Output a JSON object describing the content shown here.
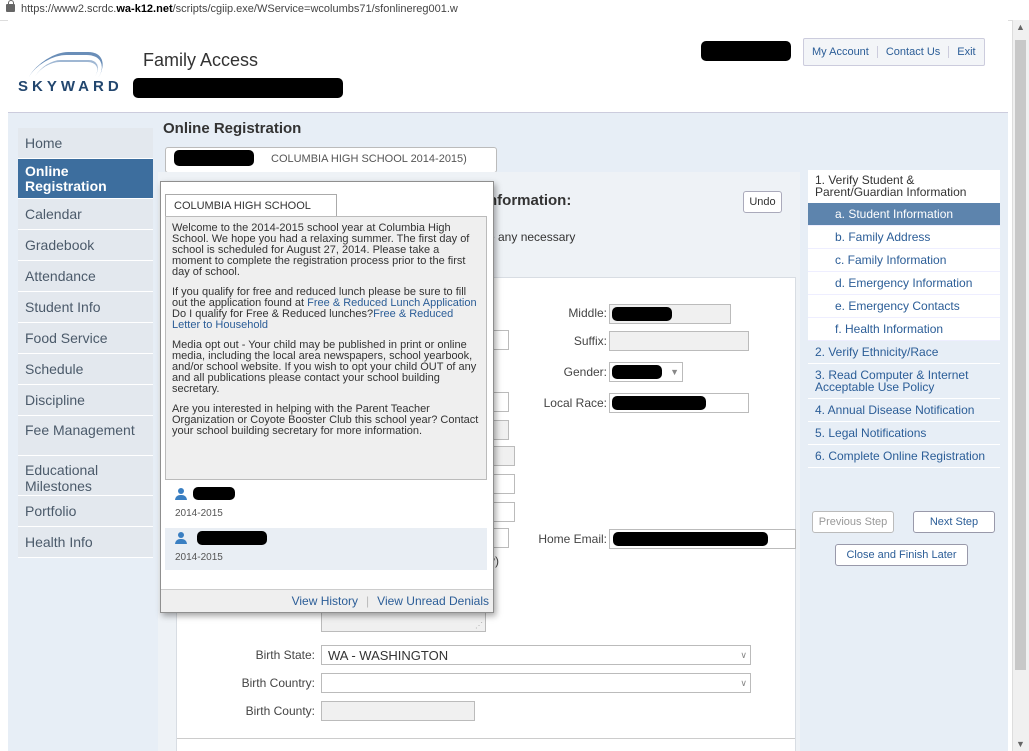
{
  "browser": {
    "url_prefix": "https://www2.scrdc.",
    "url_domain": "wa-k12.net",
    "url_path": "/scripts/cgiip.exe/WService=wcolumbs71/sfonlinereg001.w"
  },
  "header": {
    "logo_text": "SKYWARD",
    "app_title": "Family Access",
    "links": [
      "My Account",
      "Contact Us",
      "Exit"
    ]
  },
  "nav": {
    "items": [
      {
        "label": "Home"
      },
      {
        "label": "Online Registration"
      },
      {
        "label": "Calendar"
      },
      {
        "label": "Gradebook"
      },
      {
        "label": "Attendance"
      },
      {
        "label": "Student Info"
      },
      {
        "label": "Food Service"
      },
      {
        "label": "Schedule"
      },
      {
        "label": "Discipline"
      },
      {
        "label": "Fee Management"
      },
      {
        "label": "Educational Milestones"
      },
      {
        "label": "Portfolio"
      },
      {
        "label": "Health Info"
      }
    ]
  },
  "main": {
    "title": "Online Registration",
    "school_tab": "COLUMBIA HIGH SCHOOL 2014-2015)",
    "section_heading": "nformation:",
    "undo_label": "Undo",
    "instructions": "e any necessary",
    "form": {
      "middle_label": "Middle:",
      "suffix_label": "Suffix:",
      "gender_label": "Gender:",
      "local_race_label": "Local Race:",
      "home_email_label": "Home Email:",
      "partial_text": "y)",
      "birth_state_label": "Birth State:",
      "birth_state_value": "WA - WASHINGTON",
      "birth_country_label": "Birth Country:",
      "birth_county_label": "Birth County:"
    }
  },
  "popup": {
    "tab_label": "COLUMBIA HIGH SCHOOL",
    "paragraph1": "Welcome to the 2014-2015 school year at Columbia High School. We hope you had a relaxing summer. The first day of school is scheduled for August 27, 2014. Please take a moment to complete the registration process prior to the first day of school.",
    "paragraph2_intro": "If you qualify for free and reduced lunch please be sure to fill out the application found at",
    "paragraph2_link1": "Free & Reduced Lunch Application",
    "paragraph2_mid": "Do I qualify for Free & Reduced lunches?",
    "paragraph2_link2": "Free & Reduced Letter to Household",
    "paragraph3": "Media opt out - Your child may be published in print or online media, including the local area newspapers, school yearbook, and/or school website. If you wish to opt your child OUT of any and all publications please contact your school building secretary.",
    "paragraph4": "Are you interested in helping with the Parent Teacher Organization or Coyote Booster Club this school year? Contact your school building secretary for more information.",
    "students": [
      {
        "year": "2014-2015"
      },
      {
        "year": "2014-2015"
      }
    ],
    "footer_history": "View History",
    "footer_denials": "View Unread Denials"
  },
  "steps": {
    "items": [
      {
        "label": "1. Verify Student & Parent/Guardian Information",
        "kind": "top"
      },
      {
        "label": "a. Student Information",
        "kind": "active"
      },
      {
        "label": "b. Family Address",
        "kind": "sub"
      },
      {
        "label": "c. Family Information",
        "kind": "sub"
      },
      {
        "label": "d. Emergency Information",
        "kind": "sub"
      },
      {
        "label": "e. Emergency Contacts",
        "kind": "sub"
      },
      {
        "label": "f. Health Information",
        "kind": "sub"
      },
      {
        "label": "2. Verify Ethnicity/Race",
        "kind": "main"
      },
      {
        "label": "3. Read Computer & Internet Acceptable Use Policy",
        "kind": "main"
      },
      {
        "label": "4. Annual Disease Notification",
        "kind": "main"
      },
      {
        "label": "5. Legal Notifications",
        "kind": "main"
      },
      {
        "label": "6. Complete Online Registration",
        "kind": "main"
      }
    ],
    "previous_label": "Previous Step",
    "next_label": "Next Step",
    "close_label": "Close and Finish Later"
  }
}
